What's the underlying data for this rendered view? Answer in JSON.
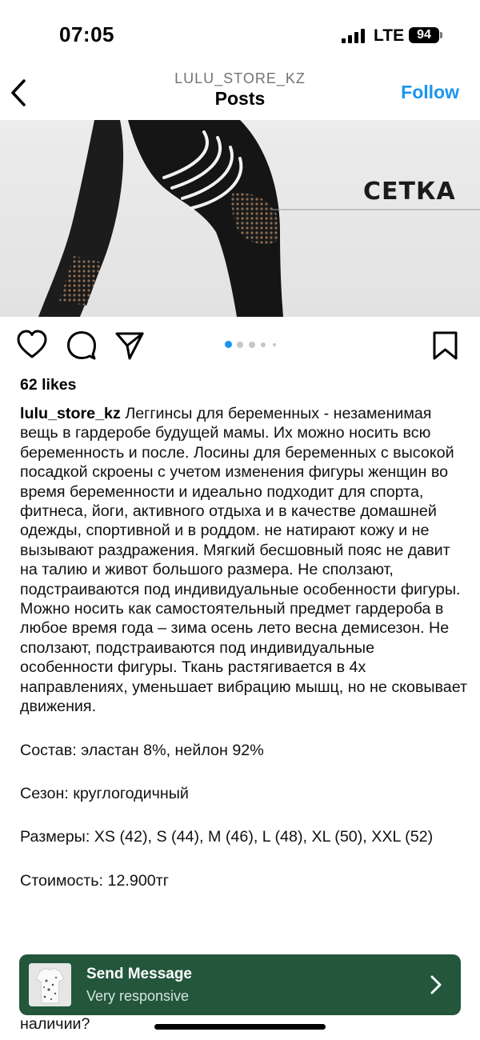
{
  "status_bar": {
    "time": "07:05",
    "network": "LTE",
    "battery": "94"
  },
  "header": {
    "subtitle": "LULU_STORE_KZ",
    "title": "Posts",
    "follow_label": "Follow"
  },
  "post_image": {
    "overlay_text": "СЕТКА",
    "carousel": {
      "count": 5,
      "active_index": 0
    }
  },
  "actions": {
    "icons": [
      "heart-icon",
      "comment-icon",
      "share-icon",
      "bookmark-icon"
    ]
  },
  "likes": "62 likes",
  "caption": {
    "username": "lulu_store_kz",
    "paragraphs": [
      "Леггинсы для беременных - незаменимая вещь в гардеробе будущей мамы. Их можно носить всю беременность и после. Лосины для беременных с высокой посадкой скроены с учетом изменения фигуры женщин во время беременности и идеально подходит для спорта, фитнеса, йоги, активного отдыха и в качестве домашней одежды, спортивной и в роддом. не натирают кожу и не вызывают раздражения. Мягкий бесшовный пояс не давит на талию и живот большого размера. Не сползают, подстраиваются под индивидуальные особенности фигуры. Можно носить как самостоятельный предмет гардероба в любое время года – зима осень лето весна демисезон. Не сползают, подстраиваются под индивидуальные особенности фигуры. Ткань растягивается в 4х направлениях, уменьшает вибрацию мышц, но не сковывает движения.",
      "Состав: эластан 8%, нейлон 92%",
      "Сезон: круглогодичный",
      "Размеры: XS (42), S (44), M (46), L (48), XL (50), XXL (52)",
      "Стоимость: 12.900тг"
    ],
    "partial_line": "наличии?"
  },
  "banner": {
    "title": "Send Message",
    "subtitle": "Very responsive",
    "background": "#23563b"
  },
  "colors": {
    "accent": "#1a96f0",
    "carousel_active": "#1a96f0",
    "carousel_inactive": "#c7c7c7"
  }
}
